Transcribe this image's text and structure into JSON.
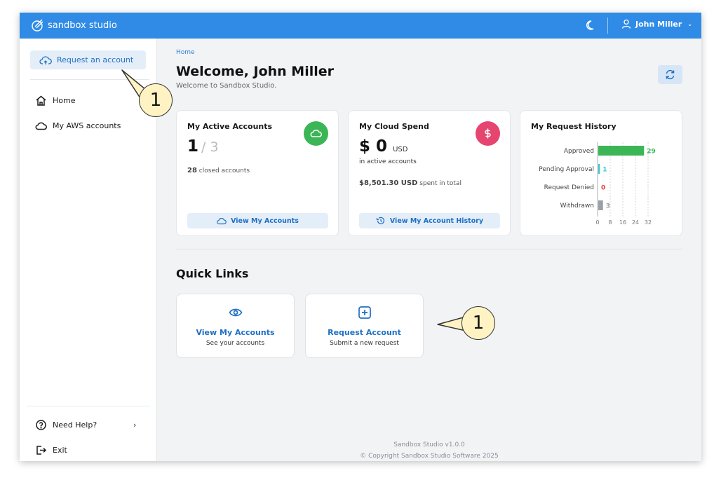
{
  "app": {
    "brand": "sandbox studio"
  },
  "header": {
    "user_name": "John Miller"
  },
  "sidebar": {
    "request_button": "Request an account",
    "items": [
      {
        "label": "Home"
      },
      {
        "label": "My AWS accounts"
      }
    ],
    "bottom_items": [
      {
        "label": "Need Help?"
      },
      {
        "label": "Exit"
      }
    ]
  },
  "main": {
    "breadcrumb": "Home",
    "welcome_title": "Welcome, John Miller",
    "welcome_sub": "Welcome to Sandbox Studio.",
    "cards": {
      "active": {
        "title": "My Active Accounts",
        "count": "1",
        "total": "/ 3",
        "closed_count": "28",
        "closed_label": "closed accounts",
        "button": "View My Accounts",
        "badge_color": "#3cb556"
      },
      "spend": {
        "title": "My Cloud Spend",
        "currency_symbol": "$",
        "amount": "0",
        "unit": "USD",
        "sub": "in active accounts",
        "total_amount": "$8,501.30 USD",
        "total_label": "spent in total",
        "button": "View My Account History",
        "badge_color": "#e5456f"
      },
      "history": {
        "title": "My Request History"
      }
    },
    "quick_links": {
      "title": "Quick Links",
      "items": [
        {
          "label": "View My Accounts",
          "sub": "See your accounts"
        },
        {
          "label": "Request Account",
          "sub": "Submit a new request"
        }
      ]
    },
    "footer": {
      "version": "Sandbox Studio v1.0.0",
      "copyright": "© Copyright Sandbox Studio Software 2025"
    }
  },
  "callouts": [
    {
      "label": "1"
    },
    {
      "label": "1"
    }
  ],
  "chart_data": {
    "type": "bar",
    "orientation": "horizontal",
    "title": "My Request History",
    "categories": [
      "Approved",
      "Pending Approval",
      "Request Denied",
      "Withdrawn"
    ],
    "values": [
      29,
      1,
      0,
      3
    ],
    "value_colors": [
      "#3cb556",
      "#3cc6c6",
      "#e53935",
      "#9aa0a6"
    ],
    "x_ticks": [
      "0",
      "8",
      "16",
      "24",
      "32"
    ],
    "xlim": [
      0,
      32
    ],
    "grid": true
  }
}
